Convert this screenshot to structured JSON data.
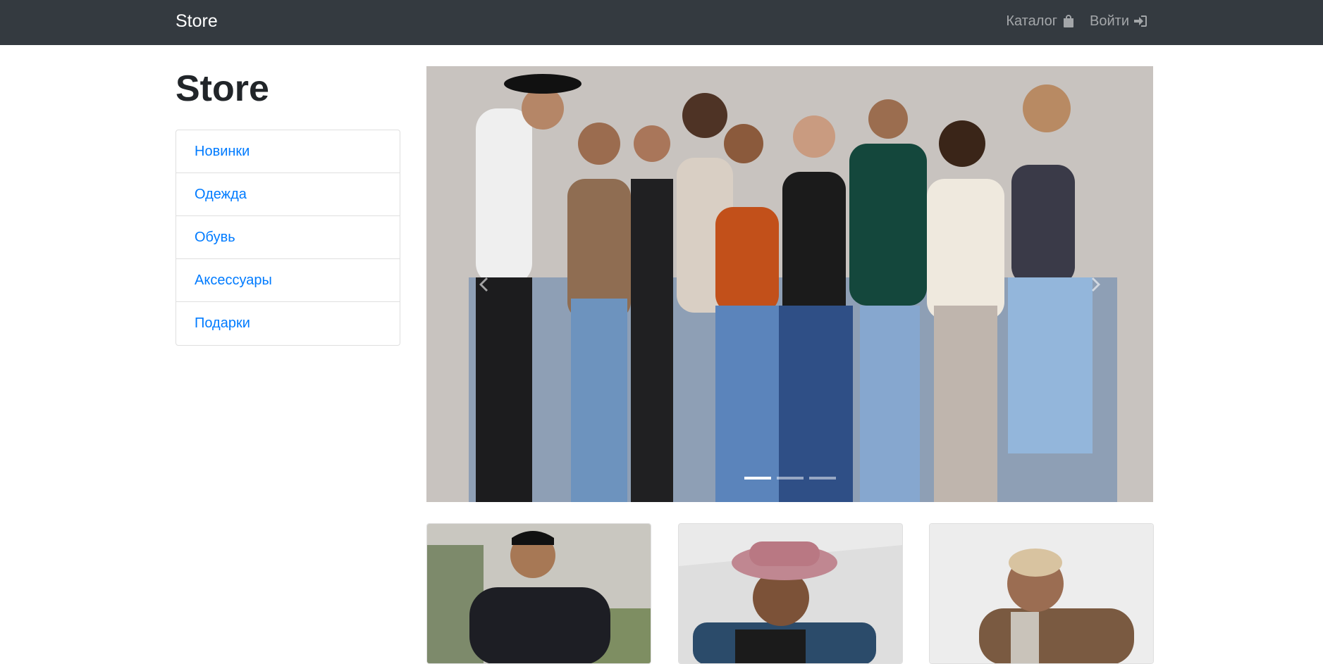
{
  "navbar": {
    "brand": "Store",
    "links": [
      {
        "label": "Каталог",
        "icon": "shopping-bag-icon"
      },
      {
        "label": "Войти",
        "icon": "sign-in-icon"
      }
    ]
  },
  "sidebar": {
    "title": "Store",
    "items": [
      {
        "label": "Новинки"
      },
      {
        "label": "Одежда"
      },
      {
        "label": "Обувь"
      },
      {
        "label": "Аксессуары"
      },
      {
        "label": "Подарки"
      }
    ]
  },
  "carousel": {
    "slide_count": 3,
    "active_slide": 1,
    "image": "group-of-models-photo"
  },
  "products": [
    {
      "image": "man-in-black-hoodie-photo"
    },
    {
      "image": "man-in-pink-bucket-hat-photo"
    },
    {
      "image": "man-in-brown-fleece-photo"
    }
  ],
  "colors": {
    "navbar_bg": "#343a40",
    "link": "#007bff",
    "title": "#212529"
  }
}
